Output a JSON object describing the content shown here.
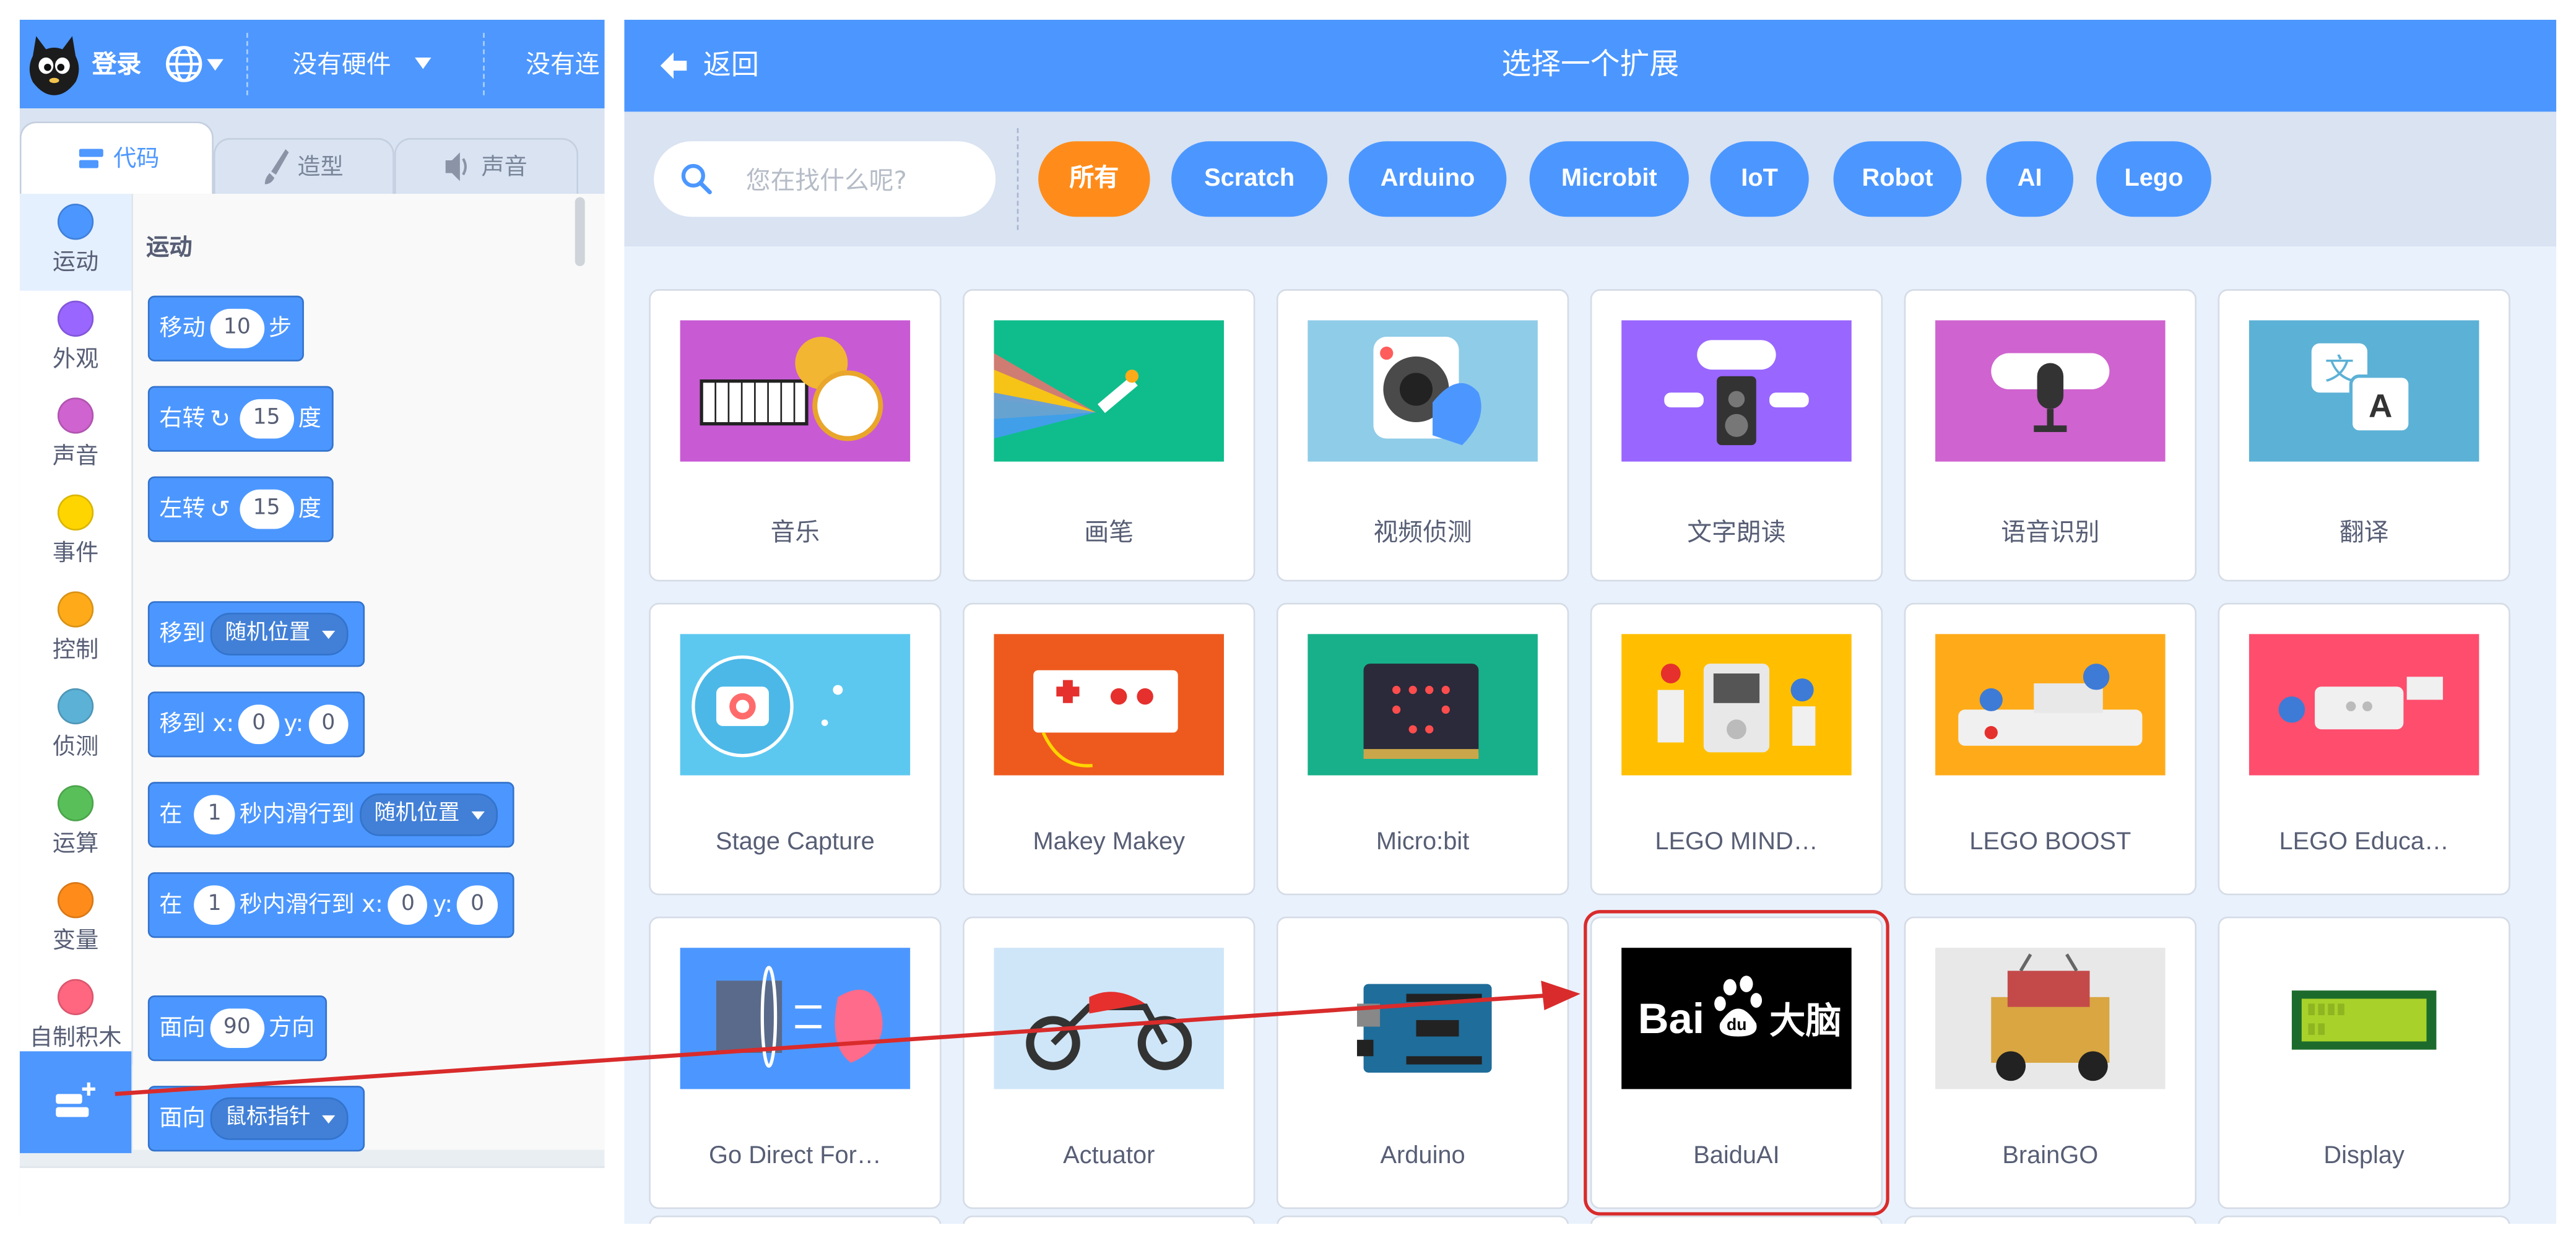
{
  "left_panel": {
    "menubar": {
      "login": "登录",
      "hardware": "没有硬件",
      "connection": "没有连"
    },
    "tabs": [
      {
        "label": "代码",
        "icon": "code-icon"
      },
      {
        "label": "造型",
        "icon": "brush-icon"
      },
      {
        "label": "声音",
        "icon": "speaker-icon"
      }
    ],
    "categories": [
      {
        "label": "运动",
        "color": "#4c97ff"
      },
      {
        "label": "外观",
        "color": "#9966ff"
      },
      {
        "label": "声音",
        "color": "#cf63cf"
      },
      {
        "label": "事件",
        "color": "#ffd500"
      },
      {
        "label": "控制",
        "color": "#ffab19"
      },
      {
        "label": "侦测",
        "color": "#5cb1d6"
      },
      {
        "label": "运算",
        "color": "#59c059"
      },
      {
        "label": "变量",
        "color": "#ff8c1a"
      },
      {
        "label": "自制积木",
        "color": "#ff6680"
      }
    ],
    "palette": {
      "title": "运动",
      "blocks": {
        "move": {
          "pre": "移动",
          "value": "10",
          "post": "步"
        },
        "turn_right": {
          "pre": "右转",
          "value": "15",
          "post": "度"
        },
        "turn_left": {
          "pre": "左转",
          "value": "15",
          "post": "度"
        },
        "goto": {
          "pre": "移到",
          "menu": "随机位置"
        },
        "goto_xy": {
          "pre": "移到 x:",
          "x": "0",
          "mid": "y:",
          "y": "0"
        },
        "glide": {
          "pre": "在",
          "value": "1",
          "mid": "秒内滑行到",
          "menu": "随机位置"
        },
        "glide_xy": {
          "pre": "在",
          "value": "1",
          "mid": "秒内滑行到 x:",
          "x": "0",
          "ymid": "y:",
          "y": "0"
        },
        "point_dir": {
          "pre": "面向",
          "value": "90",
          "post": "方向"
        },
        "point_towards": {
          "pre": "面向",
          "menu": "鼠标指针"
        }
      }
    }
  },
  "right_panel": {
    "back_label": "返回",
    "title": "选择一个扩展",
    "search": {
      "placeholder": "您在找什么呢?",
      "value": ""
    },
    "filters": [
      "所有",
      "Scratch",
      "Arduino",
      "Microbit",
      "IoT",
      "Robot",
      "AI",
      "Lego"
    ],
    "active_filter": "所有",
    "extensions": [
      {
        "label": "音乐",
        "bg": "#c85ad4"
      },
      {
        "label": "画笔",
        "bg": "#0fbd8c"
      },
      {
        "label": "视频侦测",
        "bg": "#8fcce8"
      },
      {
        "label": "文字朗读",
        "bg": "#9966ff"
      },
      {
        "label": "语音识别",
        "bg": "#cf63cf"
      },
      {
        "label": "翻译",
        "bg": "#5cb1d6"
      },
      {
        "label": "Stage Capture",
        "bg": "#5cc8f0"
      },
      {
        "label": "Makey Makey",
        "bg": "#ee5a1e"
      },
      {
        "label": "Micro:bit",
        "bg": "#17b08a"
      },
      {
        "label": "LEGO MIND…",
        "bg": "#ffbf00"
      },
      {
        "label": "LEGO BOOST",
        "bg": "#ffab19"
      },
      {
        "label": "LEGO Educa…",
        "bg": "#ff4d6d"
      },
      {
        "label": "Go Direct For…",
        "bg": "#4c97ff"
      },
      {
        "label": "Actuator",
        "bg": "#cfe6f8"
      },
      {
        "label": "Arduino",
        "bg": "#ffffff"
      },
      {
        "label": "BaiduAI",
        "bg": "#000000",
        "logo_text": "Bai大脑"
      },
      {
        "label": "BrainGO",
        "bg": "#e8e8e8"
      },
      {
        "label": "Display",
        "bg": "#ffffff"
      }
    ],
    "highlighted": "BaiduAI"
  },
  "annotation": {
    "arrow_color": "#d92b2b"
  }
}
